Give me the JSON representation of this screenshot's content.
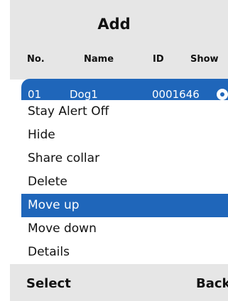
{
  "header": {
    "title": "Add",
    "columns": [
      "No.",
      "Name",
      "ID",
      "Show"
    ]
  },
  "selected_row": {
    "no": "01",
    "name": "Dog1",
    "id": "0001646",
    "show_icon": "eye-icon"
  },
  "menu": {
    "items": [
      "Stay Alert Off",
      "Hide",
      "Share collar",
      "Delete",
      "Move up",
      "Move down",
      "Details"
    ],
    "highlighted": "Move up"
  },
  "softkeys": {
    "left": "Select",
    "right": "Back"
  },
  "colors": {
    "accent": "#1f66ba",
    "bar_background": "#e6e6e6"
  }
}
